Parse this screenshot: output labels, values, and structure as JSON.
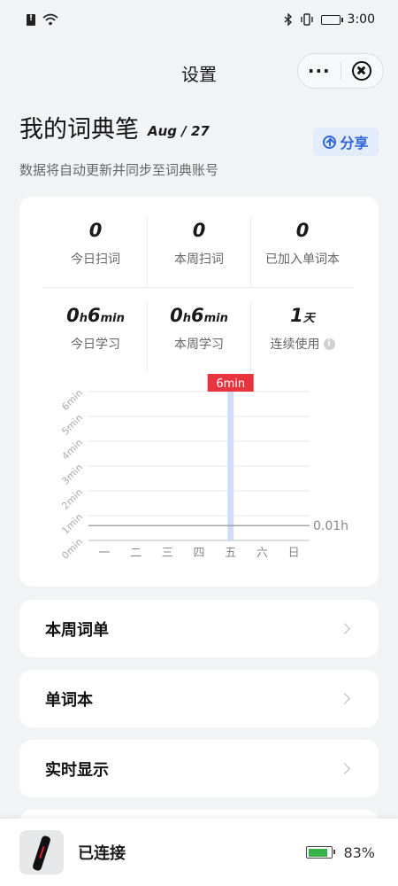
{
  "status_bar": {
    "time": "3:00",
    "icons": [
      "sim-alert-icon",
      "wifi-icon",
      "bluetooth-icon",
      "vibrate-icon",
      "battery-icon"
    ]
  },
  "nav": {
    "title": "设置",
    "more_label": "···",
    "close_icon": "close-circle-icon"
  },
  "header": {
    "title": "我的词典笔",
    "date": "Aug / 27",
    "subtitle": "数据将自动更新并同步至词典账号",
    "share_label": "分享",
    "share_icon": "share-up-icon",
    "accent_color": "#2f67d8"
  },
  "stats": {
    "row1": [
      {
        "value": "0",
        "label": "今日扫词"
      },
      {
        "value": "0",
        "label": "本周扫词"
      },
      {
        "value": "0",
        "label": "已加入单词本"
      }
    ],
    "row2": [
      {
        "h": "0",
        "h_unit": "h",
        "m": "6",
        "m_unit": "min",
        "label": "今日学习"
      },
      {
        "h": "0",
        "h_unit": "h",
        "m": "6",
        "m_unit": "min",
        "label": "本周学习"
      },
      {
        "value": "1",
        "unit": "天",
        "label": "连续使用",
        "info_icon": "i"
      }
    ]
  },
  "chart_data": {
    "type": "bar",
    "categories": [
      "一",
      "二",
      "三",
      "四",
      "五",
      "六",
      "日"
    ],
    "values": [
      0,
      0,
      0,
      0,
      6,
      0,
      0
    ],
    "y_ticks": [
      "0min",
      "1min",
      "2min",
      "3min",
      "4min",
      "5min",
      "6min"
    ],
    "ylim": [
      0,
      6
    ],
    "highlight_label": "6min",
    "reference_line": {
      "value": 0.6,
      "label": "0.01h"
    },
    "bar_color": "#cfdef7",
    "highlight_color": "#e8343e",
    "grid": true
  },
  "menu": [
    {
      "label": "本周词单"
    },
    {
      "label": "单词本"
    },
    {
      "label": "实时显示"
    }
  ],
  "device": {
    "status": "已连接",
    "battery": "83%",
    "battery_level": 0.83,
    "battery_color": "#35b34a"
  }
}
